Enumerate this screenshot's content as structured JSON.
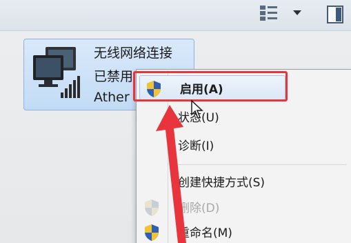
{
  "connection": {
    "name": "无线网络连接",
    "status": "已禁用",
    "adapter": "Ather"
  },
  "context_menu": {
    "items": [
      {
        "label": "启用(A)",
        "icon": "shield-icon",
        "bold": true,
        "disabled": false,
        "highlighted": true
      },
      {
        "label": "状态(U)",
        "icon": "",
        "bold": false,
        "disabled": false,
        "highlighted": false
      },
      {
        "label": "诊断(I)",
        "icon": "",
        "bold": false,
        "disabled": false,
        "highlighted": false
      },
      {
        "label": "创建快捷方式(S)",
        "icon": "",
        "bold": false,
        "disabled": false,
        "highlighted": false
      },
      {
        "label": "删除(D)",
        "icon": "shield-icon",
        "bold": false,
        "disabled": true,
        "highlighted": false
      },
      {
        "label": "重命名(M)",
        "icon": "shield-icon",
        "bold": false,
        "disabled": false,
        "highlighted": false
      }
    ]
  },
  "toolbar": {
    "icons": [
      "change-view-icon",
      "dropdown-arrow-icon",
      "preview-pane-icon"
    ]
  },
  "colors": {
    "annotation_red": "#e8353d",
    "selection_blue": "#c2dbf5",
    "menu_background": "#f3f3f3"
  }
}
